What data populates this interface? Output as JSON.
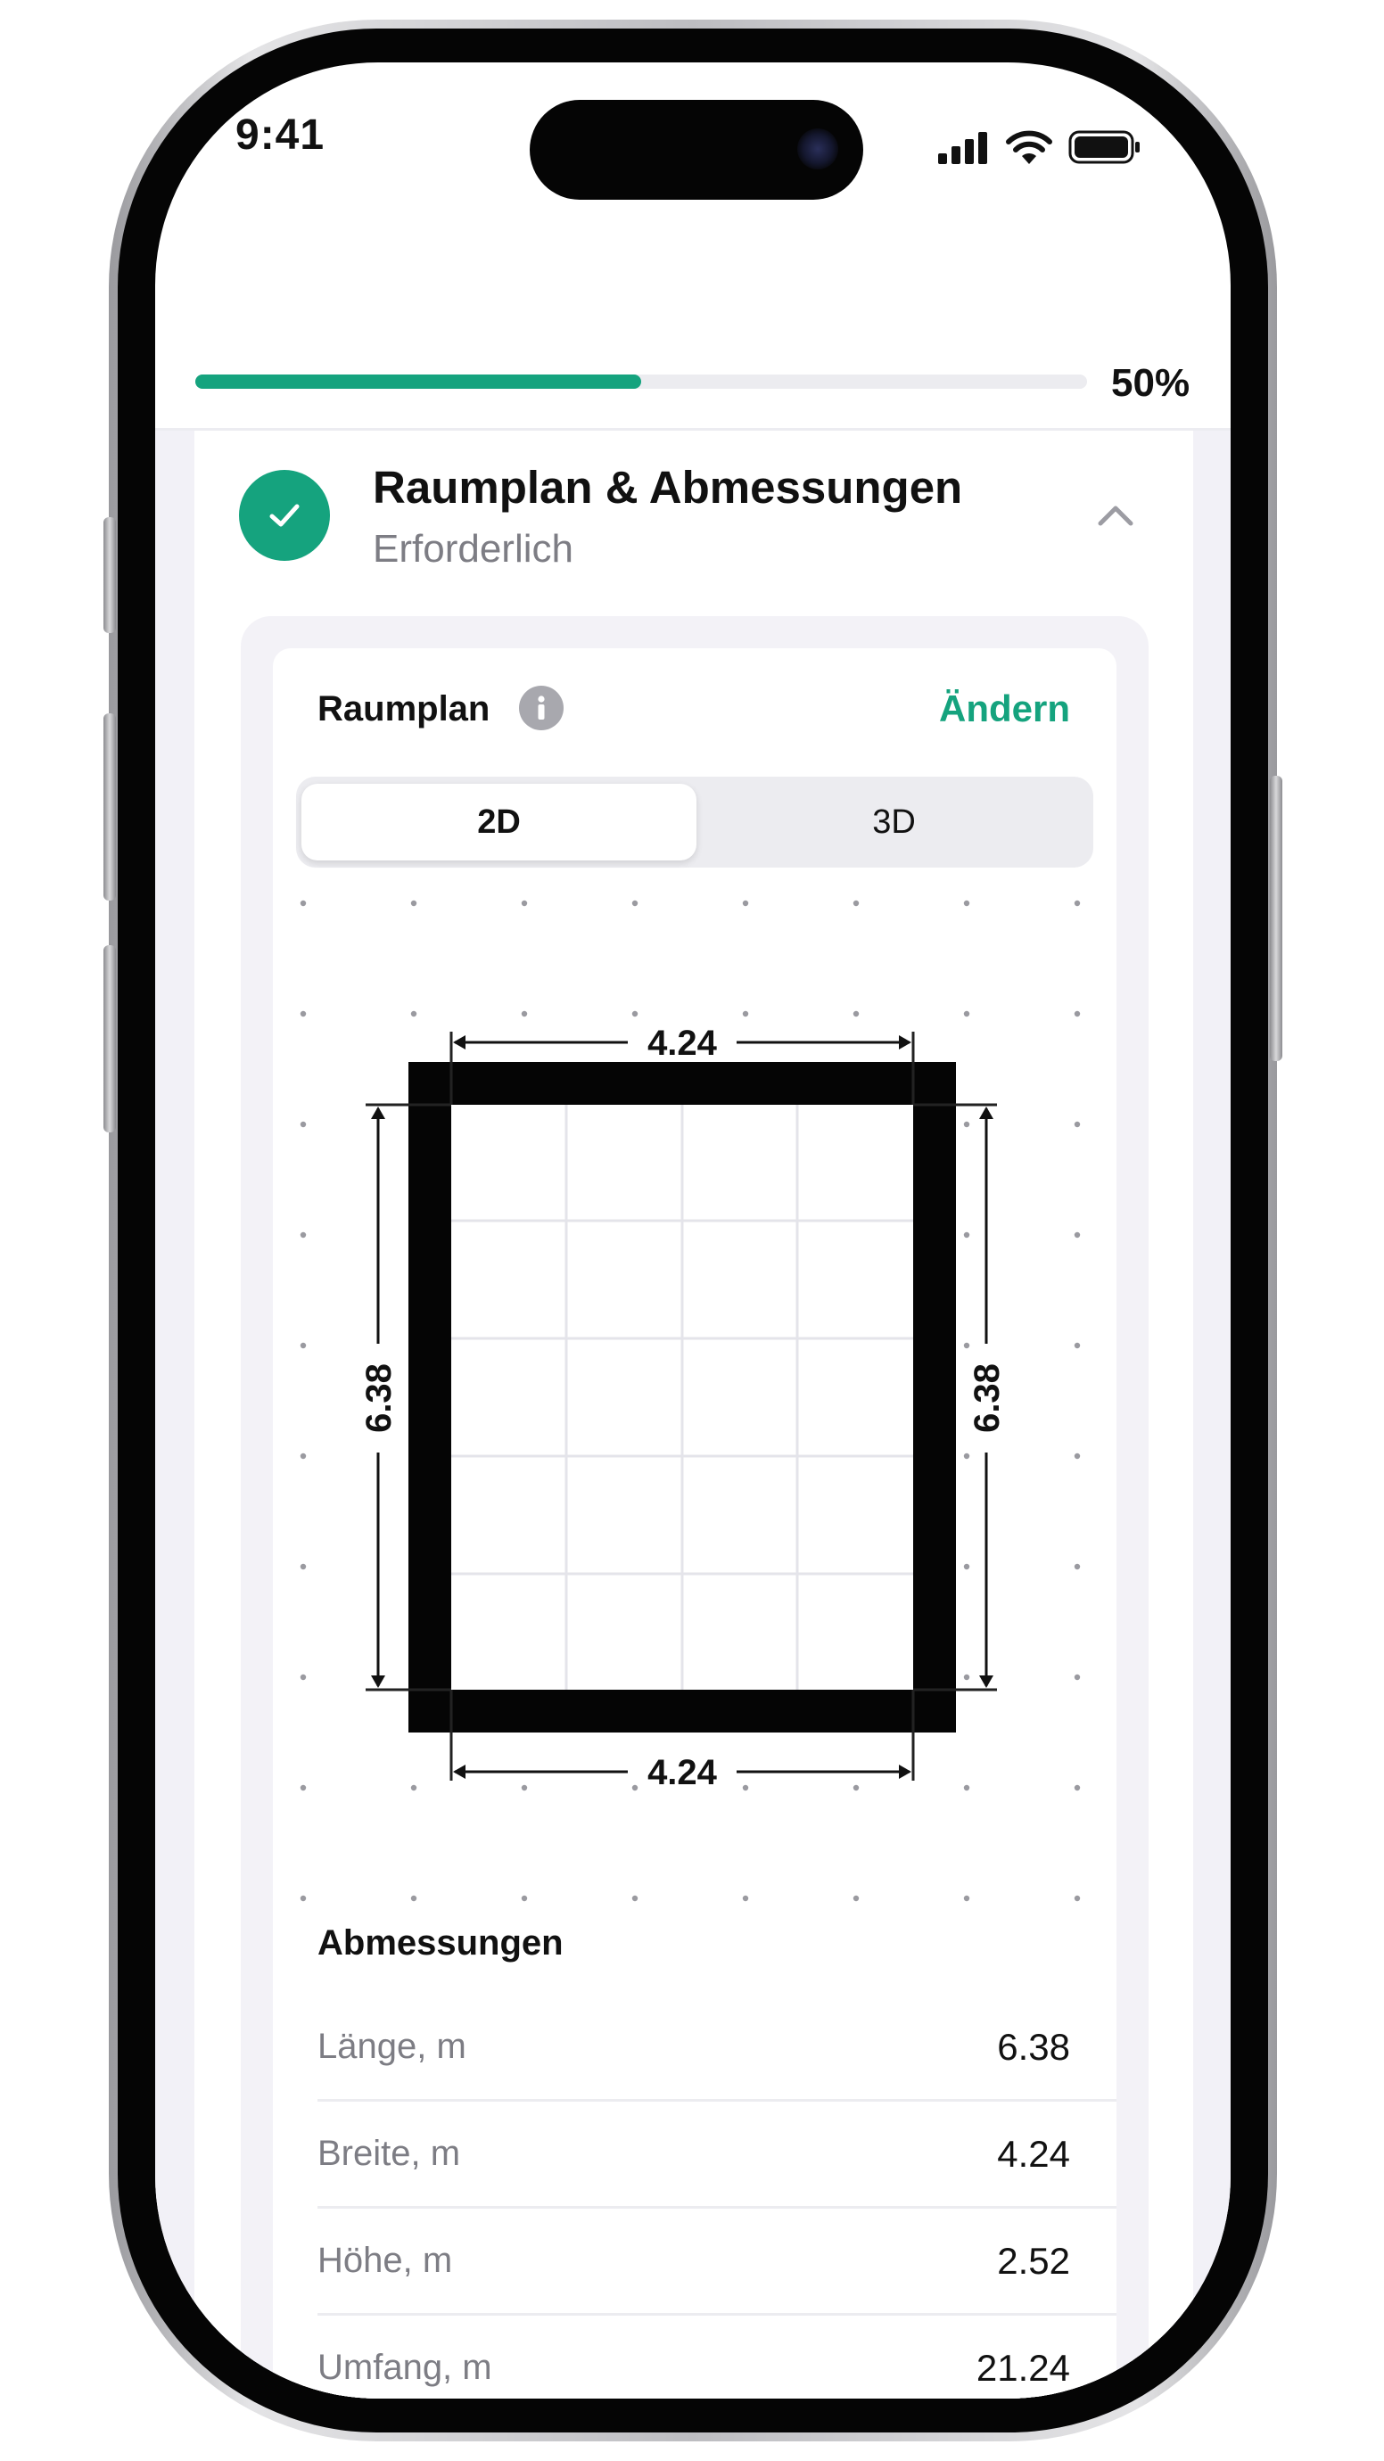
{
  "status_bar": {
    "time": "9:41"
  },
  "progress": {
    "value_fraction": 0.5,
    "label": "50%"
  },
  "section": {
    "title": "Raumplan & Abmessungen",
    "subtitle": "Erforderlich"
  },
  "plan_card": {
    "label": "Raumplan",
    "change_label": "Ändern",
    "view_toggle": {
      "options": [
        "2D",
        "3D"
      ],
      "selected": "2D"
    },
    "floorplan": {
      "width_label": "4.24",
      "length_label": "6.38"
    }
  },
  "dimensions": {
    "title": "Abmessungen",
    "rows": [
      {
        "label": "Länge, m",
        "value": "6.38"
      },
      {
        "label": "Breite, m",
        "value": "4.24"
      },
      {
        "label": "Höhe, m",
        "value": "2.52"
      },
      {
        "label": "Umfang, m",
        "value": "21.24"
      }
    ]
  },
  "colors": {
    "accent": "#15a37e",
    "background": "#f2f1f7",
    "wall": "#050505"
  }
}
